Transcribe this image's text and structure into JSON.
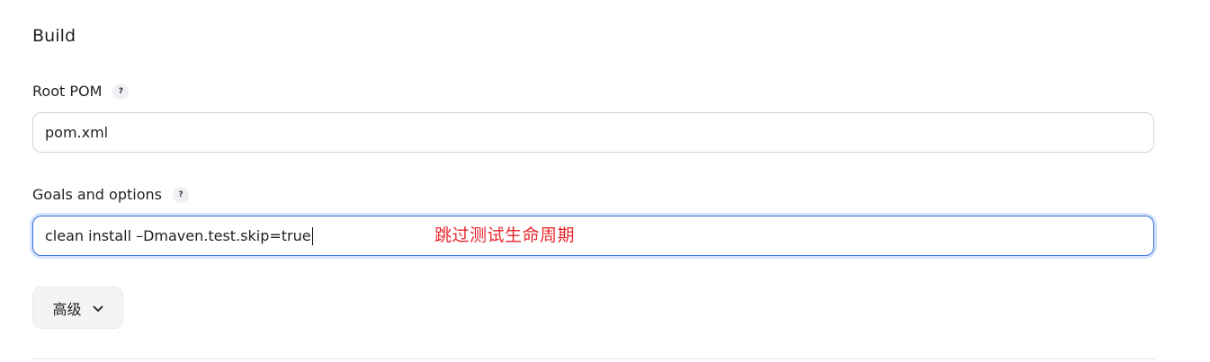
{
  "section": {
    "title": "Build"
  },
  "root_pom": {
    "label": "Root POM",
    "help": "?",
    "value": "pom.xml"
  },
  "goals": {
    "label": "Goals and options",
    "help": "?",
    "value": "clean install –Dmaven.test.skip=true"
  },
  "annotation": {
    "text": "跳过测试生命周期",
    "color": "#e8262b"
  },
  "advanced": {
    "label": "高级"
  },
  "colors": {
    "focus_border": "#2f6fdb",
    "focus_ring": "#d6e4fb"
  }
}
